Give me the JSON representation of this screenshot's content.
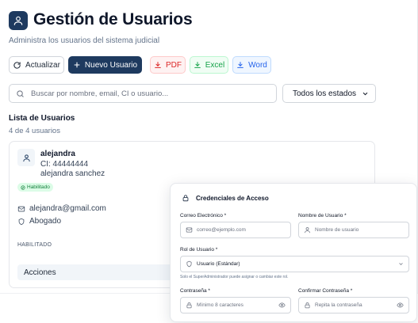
{
  "header": {
    "title": "Gestión de Usuarios",
    "subtitle": "Administra los usuarios del sistema judicial"
  },
  "toolbar": {
    "refresh_label": "Actualizar",
    "new_user_label": "Nuevo Usuario",
    "pdf_label": "PDF",
    "excel_label": "Excel",
    "word_label": "Word"
  },
  "filters": {
    "search_placeholder": "Buscar por nombre, email, CI o usuario...",
    "status_selected": "Todos los estados"
  },
  "list": {
    "title": "Lista de Usuarios",
    "count": "4 de 4 usuarios"
  },
  "user_card": {
    "username": "alejandra",
    "ci": "CI: 44444444",
    "full_name": "alejandra sanchez",
    "status": "Habilitado",
    "email": "alejandra@gmail.com",
    "role": "Abogado",
    "status_label": "HABILITADO",
    "actions_label": "Acciones"
  },
  "credentials": {
    "title": "Credenciales de Acceso",
    "email_label": "Correo Electrónico *",
    "email_placeholder": "correo@ejemplo.com",
    "username_label": "Nombre de Usuario *",
    "username_placeholder": "Nombre de usuario",
    "role_label": "Rol de Usuario *",
    "role_selected": "Usuario (Estándar)",
    "role_hint": "Solo el SuperAdministrador puede asignar o cambiar este rol.",
    "password_label": "Contraseña *",
    "password_placeholder": "Mínimo 8 caracteres",
    "confirm_label": "Confirmar Contraseña *",
    "confirm_placeholder": "Repita la contraseña"
  },
  "colors": {
    "primary": "#1e3a5f",
    "pdf": "#dc2626",
    "excel": "#16a34a",
    "word": "#2563eb",
    "enabled": "#15803d"
  }
}
